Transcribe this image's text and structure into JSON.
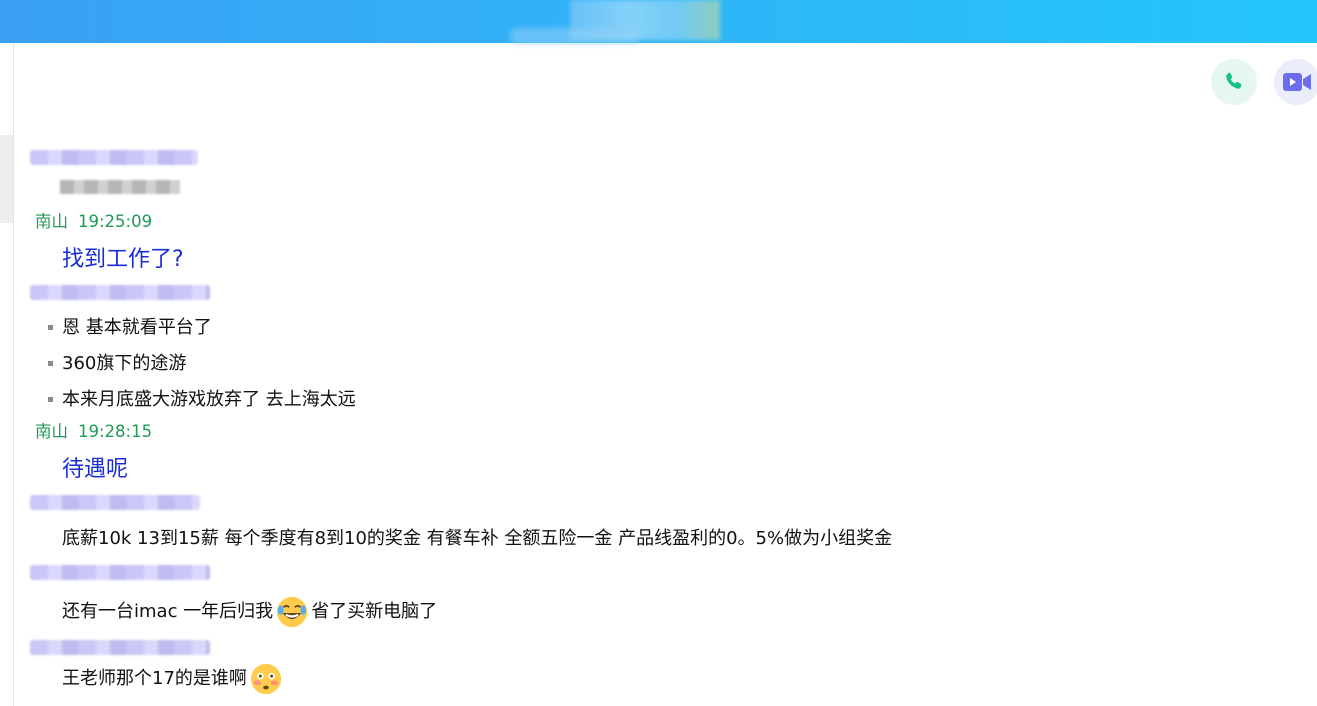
{
  "chat": {
    "messages": [
      {
        "sender": "南山",
        "time": "19:25:09",
        "text": "找到工作了?"
      },
      {
        "bullets": [
          "恩 基本就看平台了",
          "360旗下的途游",
          "本来月底盛大游戏放弃了 去上海太远"
        ]
      },
      {
        "sender": "南山",
        "time": "19:28:15",
        "text": "待遇呢"
      },
      {
        "text": "底薪10k 13到15薪 每个季度有8到10的奖金 有餐车补 全额五险一金 产品线盈利的0。5%做为小组奖金"
      },
      {
        "text_before": "还有一台imac 一年后归我",
        "emoji": "joy-emoji",
        "text_after": "省了买新电脑了"
      },
      {
        "text_before": "王老师那个17的是谁啊",
        "emoji": "flushed-emoji"
      }
    ]
  },
  "colors": {
    "accent_green": "#1f9a56",
    "accent_blue": "#1a2ed8",
    "phone_icon": "#18c08a",
    "video_icon": "#6b6ef0"
  },
  "icons": {
    "call": "phone-icon",
    "video": "video-camera-icon"
  }
}
